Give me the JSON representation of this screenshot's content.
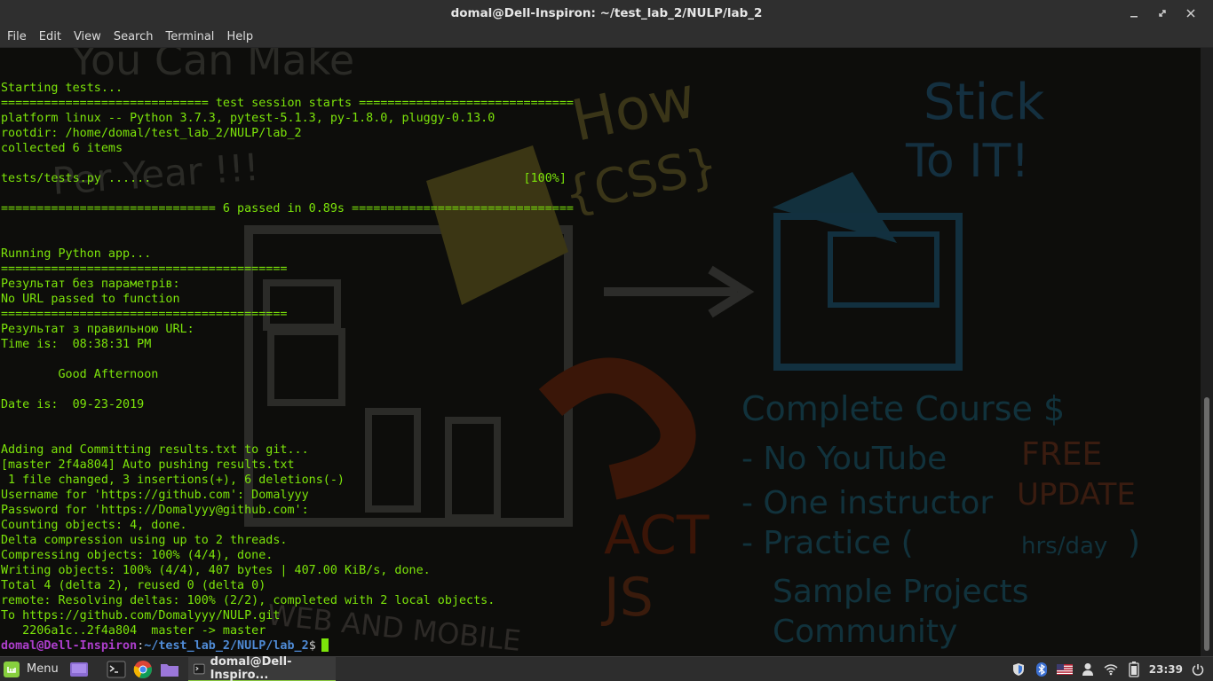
{
  "window": {
    "title": "domal@Dell-Inspiron: ~/test_lab_2/NULP/lab_2"
  },
  "menu": [
    "File",
    "Edit",
    "View",
    "Search",
    "Terminal",
    "Help"
  ],
  "terminal": {
    "lines": [
      "Starting tests...",
      "============================= test session starts ==============================",
      "platform linux -- Python 3.7.3, pytest-5.1.3, py-1.8.0, pluggy-0.13.0",
      "rootdir: /home/domal/test_lab_2/NULP/lab_2",
      "collected 6 items",
      "",
      "tests/tests.py ......                                                    [100%]",
      "",
      "============================== 6 passed in 0.89s ===============================",
      "",
      "",
      "Running Python app...",
      "========================================",
      "Результат без параметрів:",
      "No URL passed to function",
      "========================================",
      "Результат з правильною URL:",
      "Time is:  08:38:31 PM",
      "",
      "        Good Afternoon",
      "",
      "Date is:  09-23-2019",
      "",
      "",
      "Adding and Committing results.txt to git...",
      "[master 2f4a804] Auto pushing results.txt",
      " 1 file changed, 3 insertions(+), 6 deletions(-)",
      "Username for 'https://github.com': Domalyyy",
      "Password for 'https://Domalyyy@github.com':",
      "Counting objects: 4, done.",
      "Delta compression using up to 2 threads.",
      "Compressing objects: 100% (4/4), done.",
      "Writing objects: 100% (4/4), 407 bytes | 407.00 KiB/s, done.",
      "Total 4 (delta 2), reused 0 (delta 0)",
      "remote: Resolving deltas: 100% (2/2), completed with 2 local objects.",
      "To https://github.com/Domalyyy/NULP.git",
      "   2206a1c..2f4a804  master -> master"
    ],
    "prompt": {
      "user": "domal@Dell-Inspiron",
      "sep": ":",
      "path": "~/test_lab_2/NULP/lab_2",
      "symbol": "$"
    }
  },
  "wallpaper_text": [
    "You Can Make",
    "Per Year !!!",
    "How",
    "{CSS}",
    "Stick",
    "To IT!",
    "Complete Course $",
    "- No YouTube",
    "FREE",
    "- One instructor",
    "UPDATE",
    "- Practice (",
    "hrs/day",
    ")",
    "Sample Projects",
    "Community",
    "ACT",
    "JS",
    "WEB AND MOBILE"
  ],
  "panel": {
    "menu_label": "Menu",
    "task_label": "domal@Dell-Inspiro...",
    "clock": "23:39",
    "icons": [
      "shield-icon",
      "bluetooth-icon",
      "us-flag-icon",
      "user-icon",
      "wifi-icon",
      "battery-icon",
      "power-icon"
    ]
  },
  "colors": {
    "terminal_text": "#7ce40a",
    "prompt_user": "#ad3ecc",
    "prompt_path": "#4f8bd6",
    "panel_accent": "#8ac93f"
  }
}
